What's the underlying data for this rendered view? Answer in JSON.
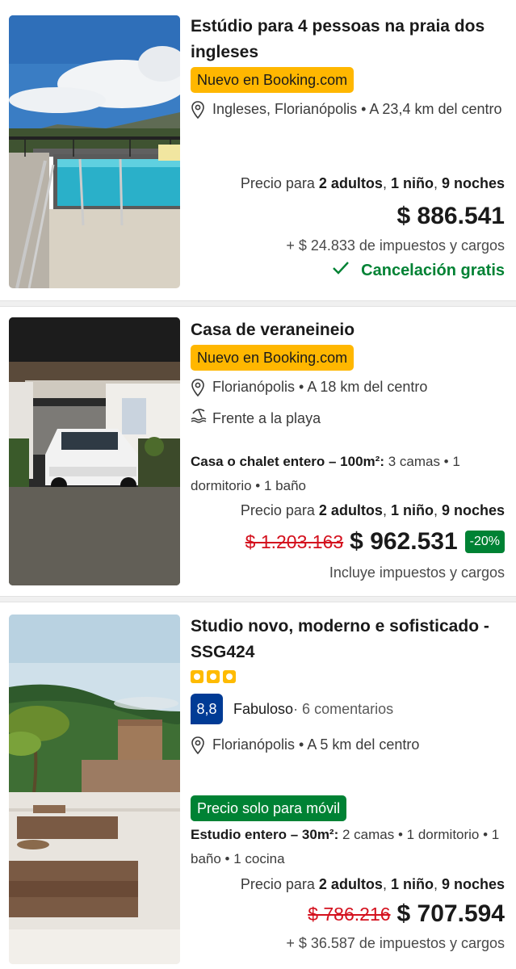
{
  "listings": [
    {
      "title": "Estúdio para 4 pessoas na praia dos ingleses",
      "badge": "Nuevo en Booking.com",
      "location": "Ingleses, Florianópolis • A 23,4 km del centro",
      "price_for_prefix": "Precio para ",
      "adults": "2 adultos",
      "child": "1 niño",
      "nights": "9 noches",
      "price": "$ 886.541",
      "taxes": "+ $ 24.833 de impuestos y cargos",
      "cancellation": "Cancelación gratis",
      "photo_icon": "pool-photo"
    },
    {
      "title": "Casa de veraneineio",
      "badge": "Nuevo en Booking.com",
      "location": "Florianópolis • A 18 km del centro",
      "beach": "Frente a la playa",
      "unit_type": "Casa o chalet entero – 100m²:",
      "unit_rest": " 3 camas • 1 dormitorio • 1 baño",
      "price_for_prefix": "Precio para ",
      "adults": "2 adultos",
      "child": "1 niño",
      "nights": "9 noches",
      "old_price": "$ 1.203.163",
      "price": "$ 962.531",
      "discount": "-20%",
      "taxes": "Incluye impuestos y cargos",
      "photo_icon": "garage-car-photo"
    },
    {
      "title": "Studio novo, moderno e sofisticado - SSG424",
      "stars": 3,
      "score": "8,8",
      "score_word": "Fabuloso",
      "reviews": " · 6 comentarios",
      "location": "Florianópolis • A 5 km del centro",
      "mobile_badge": "Precio solo para móvil",
      "unit_type": "Estudio entero – 30m²:",
      "unit_rest": " 2 camas • 1 dormitorio • 1 baño • 1 cocina",
      "price_for_prefix": "Precio para ",
      "adults": "2 adultos",
      "child": "1 niño",
      "nights": "9 noches",
      "old_price": "$ 786.216",
      "price": "$ 707.594",
      "taxes": "+ $ 36.587 de impuestos y cargos",
      "photo_icon": "terrace-photo"
    }
  ],
  "colors": {
    "badge_yellow": "#ffb700",
    "green": "#008234",
    "strike_red": "#d4111e",
    "score_blue": "#003b95"
  }
}
